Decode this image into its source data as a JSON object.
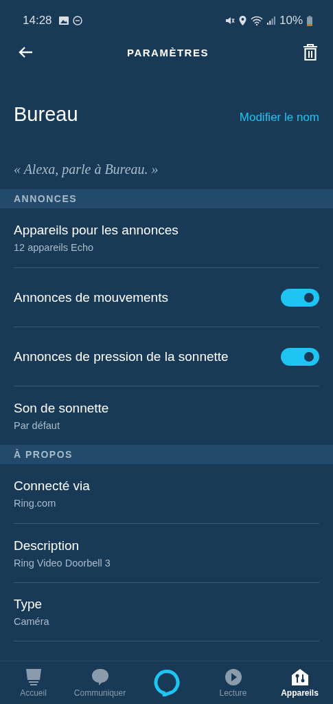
{
  "status_bar": {
    "time": "14:28",
    "battery": "10%"
  },
  "header": {
    "title": "PARAMÈTRES"
  },
  "device": {
    "name": "Bureau",
    "rename_link": "Modifier le nom",
    "phrase": "« Alexa, parle à Bureau. »"
  },
  "sections": [
    {
      "title": "ANNONCES",
      "items": [
        {
          "kind": "link",
          "title": "Appareils pour les annonces",
          "subtitle": "12 appareils Echo"
        },
        {
          "kind": "toggle",
          "title": "Annonces de mouvements",
          "on": true
        },
        {
          "kind": "toggle",
          "title": "Annonces de pression de la sonnette",
          "on": true
        },
        {
          "kind": "link",
          "title": "Son de sonnette",
          "subtitle": "Par défaut"
        }
      ]
    },
    {
      "title": "À PROPOS",
      "items": [
        {
          "kind": "link",
          "title": "Connecté via",
          "subtitle": "Ring.com"
        },
        {
          "kind": "link",
          "title": "Description",
          "subtitle": "Ring Video Doorbell 3"
        },
        {
          "kind": "link",
          "title": "Type",
          "subtitle": "Caméra"
        }
      ]
    }
  ],
  "nav": [
    {
      "kind": "home",
      "label": "Accueil",
      "selected": false
    },
    {
      "kind": "chat",
      "label": "Communiquer",
      "selected": false
    },
    {
      "kind": "alexa"
    },
    {
      "kind": "play",
      "label": "Lecture",
      "selected": false
    },
    {
      "kind": "devices",
      "label": "Appareils",
      "selected": true
    }
  ]
}
